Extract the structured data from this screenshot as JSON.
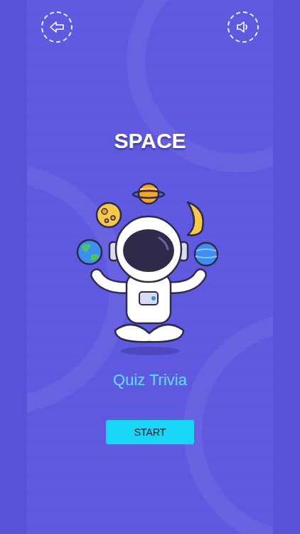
{
  "title": "SPACE",
  "subtitle": "Quiz Trivia",
  "buttons": [
    {
      "label": "START"
    }
  ]
}
